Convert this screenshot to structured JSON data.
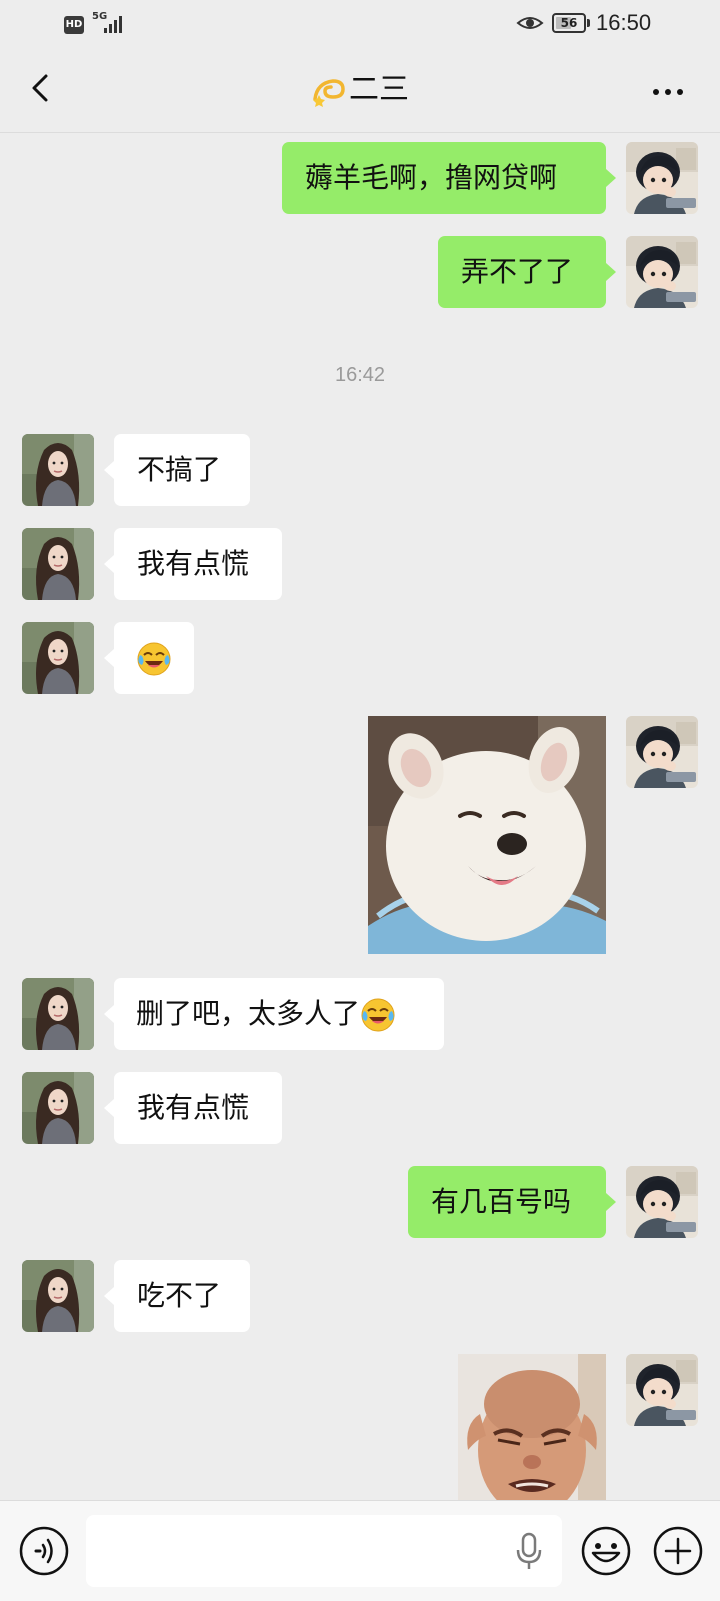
{
  "status_bar": {
    "hd_label": "HD",
    "network_label": "5G",
    "battery_level": "56",
    "battery_fraction": 0.56,
    "time": "16:50"
  },
  "header": {
    "title": "二三",
    "title_emoji_icon": "dizzy-star-emoji-icon",
    "back_icon": "chevron-left-icon",
    "more_icon": "more-dots-icon"
  },
  "messages": [
    {
      "side": "out",
      "text": "薅羊毛啊，撸网贷啊"
    },
    {
      "side": "out",
      "text": "弄不了了"
    },
    {
      "type": "timestamp",
      "text": "16:42"
    },
    {
      "side": "in",
      "text": "不搞了"
    },
    {
      "side": "in",
      "text": "我有点慌"
    },
    {
      "side": "in",
      "emoji": "crying-laughing-emoji-icon"
    },
    {
      "side": "out",
      "sticker": "smiling-white-dog-sticker"
    },
    {
      "side": "in",
      "text": "删了吧，太多人了",
      "emoji": "crying-laughing-emoji-icon"
    },
    {
      "side": "in",
      "text": "我有点慌"
    },
    {
      "side": "out",
      "text": "有几百号吗"
    },
    {
      "side": "in",
      "text": "吃不了"
    },
    {
      "side": "out",
      "sticker": "crying-man-sticker"
    }
  ],
  "input_bar": {
    "voice_icon": "voice-mode-icon",
    "input_value": "",
    "mic_icon": "microphone-icon",
    "emoji_icon": "emoji-smile-icon",
    "plus_icon": "plus-circle-icon"
  },
  "colors": {
    "background": "#ededed",
    "outgoing_bubble": "#95ec69",
    "incoming_bubble": "#ffffff",
    "timestamp_text": "#9a9a9a"
  }
}
